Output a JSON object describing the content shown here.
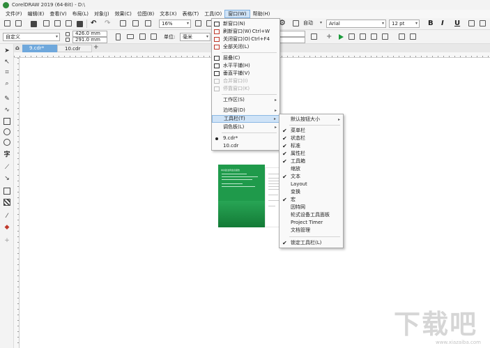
{
  "window": {
    "title": "CorelDRAW 2019 (64-Bit) - D:\\"
  },
  "menubar": {
    "items": [
      "文件(F)",
      "编辑(E)",
      "查看(V)",
      "布局(L)",
      "对象(J)",
      "效果(C)",
      "位图(B)",
      "文本(X)",
      "表格(T)",
      "工具(O)",
      "窗口(W)",
      "帮助(H)"
    ],
    "active_index": 10
  },
  "toolbar1": {
    "zoom": "16%",
    "font_name": "Arial",
    "font_size": "12 pt",
    "snap_label": "自动",
    "bold": "B",
    "italic": "I",
    "underline": "U"
  },
  "toolbar2": {
    "preset": "自定义",
    "width": "426.0 mm",
    "height": "291.0 mm",
    "unit_label": "单位:",
    "unit_value": "毫米"
  },
  "tabs": [
    {
      "label": "9.cdr*",
      "active": true
    },
    {
      "label": "10.cdr",
      "active": false
    }
  ],
  "window_menu": {
    "items": [
      {
        "label": "新窗口(N)",
        "icon": "new-window-icon",
        "enabled": true
      },
      {
        "label": "刷新窗口(W)",
        "shortcut": "Ctrl+W",
        "icon": "refresh-window-icon",
        "enabled": true
      },
      {
        "label": "关闭窗口(O)",
        "shortcut": "Ctrl+F4",
        "icon": "close-window-icon",
        "enabled": true
      },
      {
        "label": "全部关闭(L)",
        "icon": "close-all-icon",
        "enabled": true
      },
      {
        "label": "层叠(C)",
        "icon": "cascade-icon",
        "enabled": true
      },
      {
        "label": "水平平铺(H)",
        "icon": "tile-horizontal-icon",
        "enabled": true
      },
      {
        "label": "垂直平铺(V)",
        "icon": "tile-vertical-icon",
        "enabled": true
      },
      {
        "label": "合并窗口(I)",
        "icon": "merge-windows-icon",
        "enabled": false
      },
      {
        "label": "停靠窗口(K)",
        "icon": "dock-window-icon",
        "enabled": false
      },
      {
        "label": "工作区(S)",
        "submenu": true,
        "enabled": true
      },
      {
        "label": "泊坞窗(D)",
        "submenu": true,
        "enabled": true
      },
      {
        "label": "工具栏(T)",
        "submenu": true,
        "enabled": true,
        "highlighted": true
      },
      {
        "label": "调色板(L)",
        "submenu": true,
        "enabled": true
      },
      {
        "label": "9.cdr*",
        "bullet": true,
        "enabled": true
      },
      {
        "label": "10.cdr",
        "enabled": true
      }
    ]
  },
  "toolbars_submenu": {
    "items": [
      {
        "label": "默认按钮大小",
        "checked": false,
        "submenu": true
      },
      {
        "label": "菜单栏",
        "checked": true
      },
      {
        "label": "状态栏",
        "checked": true
      },
      {
        "label": "标准",
        "checked": true
      },
      {
        "label": "属性栏",
        "checked": true
      },
      {
        "label": "工具箱",
        "checked": true
      },
      {
        "label": "缩放",
        "checked": false
      },
      {
        "label": "文本",
        "checked": true
      },
      {
        "label": "Layout",
        "checked": false
      },
      {
        "label": "变换",
        "checked": false
      },
      {
        "label": "宏",
        "checked": true
      },
      {
        "label": "因特网",
        "checked": false
      },
      {
        "label": "轮式设备工具面板",
        "checked": false
      },
      {
        "label": "Project Timer",
        "checked": false
      },
      {
        "label": "文档管理",
        "checked": false
      },
      {
        "label": "锁定工具栏(L)",
        "checked": true
      }
    ]
  },
  "thumbnail": {
    "title_text": "中共政治局会议报告"
  },
  "watermark": {
    "main": "下载吧",
    "sub": "www.xiazaiba.com"
  },
  "colors": {
    "accent": "#6fa8dc",
    "menu_highlight": "#cfe3f7",
    "thumb_green": "#1f9a4b"
  }
}
